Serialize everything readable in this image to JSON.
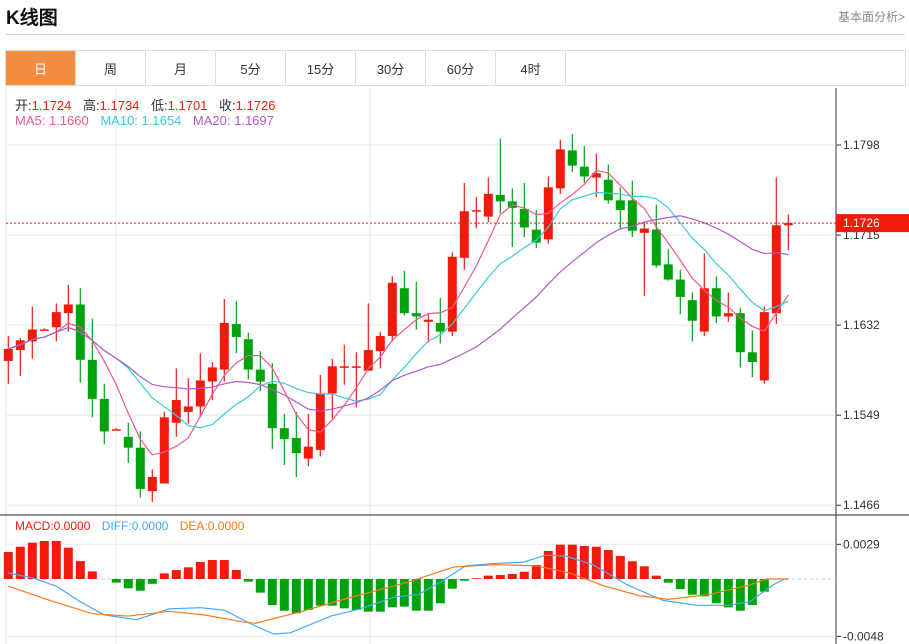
{
  "header": {
    "title": "K线图",
    "more_link": "基本面分析>"
  },
  "tabs": [
    {
      "label": "日",
      "active": true
    },
    {
      "label": "周"
    },
    {
      "label": "月"
    },
    {
      "label": "5分"
    },
    {
      "label": "15分"
    },
    {
      "label": "30分"
    },
    {
      "label": "60分"
    },
    {
      "label": "4时"
    }
  ],
  "ohlc_info": {
    "open_label": "开:",
    "open": "1.1724",
    "high_label": "高:",
    "high": "1.1734",
    "low_label": "低:",
    "low": "1.1701",
    "close_label": "收:",
    "close": "1.1726"
  },
  "ma_info": {
    "ma5": "MA5: 1.1660",
    "ma10": "MA10: 1.1654",
    "ma20": "MA20: 1.1697"
  },
  "macd_info": {
    "macd": "MACD:0.0000",
    "diff": "DIFF:0.0000",
    "dea": "DEA:0.0000"
  },
  "colors": {
    "up": "#f21b0b",
    "down": "#00a30c",
    "ma5": "#f0588f",
    "ma10": "#3cc8dc",
    "ma20": "#b15bc7",
    "diff": "#4aa8f0",
    "dea": "#f47a1f",
    "accent": "#f58c3f"
  },
  "chart_data": [
    {
      "type": "candlestick",
      "price_ticks": [
        "1.1798",
        "1.1715",
        "1.1632",
        "1.1549",
        "1.1466"
      ],
      "ylim": [
        1.1466,
        1.1798
      ],
      "current_price": "1.1726",
      "grid": true,
      "ma_periods": [
        5,
        10,
        20
      ],
      "candles_ohlc": [
        [
          1.1599,
          1.1622,
          1.1578,
          1.161
        ],
        [
          1.1609,
          1.162,
          1.1585,
          1.1618
        ],
        [
          1.1617,
          1.1649,
          1.1601,
          1.1628
        ],
        [
          1.1628,
          1.1629,
          1.1627,
          1.1628
        ],
        [
          1.163,
          1.1652,
          1.1617,
          1.1644
        ],
        [
          1.1643,
          1.1669,
          1.1626,
          1.1651
        ],
        [
          1.1651,
          1.1666,
          1.1579,
          1.16
        ],
        [
          1.16,
          1.1638,
          1.1547,
          1.1564
        ],
        [
          1.1564,
          1.1578,
          1.1522,
          1.1534
        ],
        [
          1.1536,
          1.1537,
          1.1535,
          1.1536
        ],
        [
          1.1529,
          1.1542,
          1.1505,
          1.1519
        ],
        [
          1.1519,
          1.1534,
          1.1473,
          1.1481
        ],
        [
          1.1479,
          1.1499,
          1.1469,
          1.1492
        ],
        [
          1.1486,
          1.1552,
          1.1486,
          1.1547
        ],
        [
          1.1542,
          1.1592,
          1.1529,
          1.1563
        ],
        [
          1.1552,
          1.1583,
          1.1541,
          1.1557
        ],
        [
          1.1557,
          1.1606,
          1.1547,
          1.1581
        ],
        [
          1.158,
          1.1598,
          1.1563,
          1.1593
        ],
        [
          1.1591,
          1.1656,
          1.158,
          1.1634
        ],
        [
          1.1633,
          1.1654,
          1.1606,
          1.1621
        ],
        [
          1.1619,
          1.1625,
          1.1582,
          1.1591
        ],
        [
          1.1591,
          1.1608,
          1.1571,
          1.158
        ],
        [
          1.1578,
          1.1597,
          1.1518,
          1.1537
        ],
        [
          1.1537,
          1.155,
          1.1503,
          1.1527
        ],
        [
          1.1528,
          1.1552,
          1.1492,
          1.1514
        ],
        [
          1.1509,
          1.155,
          1.1502,
          1.152
        ],
        [
          1.1517,
          1.1586,
          1.1511,
          1.1569
        ],
        [
          1.1569,
          1.1601,
          1.1546,
          1.1594
        ],
        [
          1.1594,
          1.1614,
          1.1577,
          1.1594
        ],
        [
          1.1594,
          1.1607,
          1.1556,
          1.1594
        ],
        [
          1.159,
          1.1652,
          1.159,
          1.1609
        ],
        [
          1.1608,
          1.1626,
          1.1592,
          1.1622
        ],
        [
          1.1622,
          1.1677,
          1.1617,
          1.1671
        ],
        [
          1.1666,
          1.1682,
          1.1641,
          1.1643
        ],
        [
          1.1643,
          1.1672,
          1.1628,
          1.164
        ],
        [
          1.1635,
          1.1642,
          1.1616,
          1.1637
        ],
        [
          1.1634,
          1.1657,
          1.1615,
          1.1626
        ],
        [
          1.1626,
          1.1699,
          1.1622,
          1.1695
        ],
        [
          1.1694,
          1.1763,
          1.1683,
          1.1737
        ],
        [
          1.1738,
          1.175,
          1.1721,
          1.1738
        ],
        [
          1.1732,
          1.1768,
          1.1727,
          1.1753
        ],
        [
          1.1752,
          1.1804,
          1.1735,
          1.1746
        ],
        [
          1.1746,
          1.1758,
          1.1704,
          1.174
        ],
        [
          1.1739,
          1.1763,
          1.1713,
          1.1722
        ],
        [
          1.172,
          1.1738,
          1.1703,
          1.1708
        ],
        [
          1.1711,
          1.1769,
          1.1707,
          1.1759
        ],
        [
          1.1758,
          1.1803,
          1.1753,
          1.1794
        ],
        [
          1.1793,
          1.1808,
          1.1773,
          1.1779
        ],
        [
          1.1778,
          1.1797,
          1.1763,
          1.1769
        ],
        [
          1.1768,
          1.179,
          1.175,
          1.1772
        ],
        [
          1.1766,
          1.178,
          1.1744,
          1.1747
        ],
        [
          1.1747,
          1.1759,
          1.1721,
          1.1738
        ],
        [
          1.1747,
          1.1765,
          1.1713,
          1.1719
        ],
        [
          1.1717,
          1.1727,
          1.1659,
          1.1721
        ],
        [
          1.172,
          1.1743,
          1.1685,
          1.1687
        ],
        [
          1.1688,
          1.1702,
          1.1673,
          1.1674
        ],
        [
          1.1674,
          1.1683,
          1.1642,
          1.1658
        ],
        [
          1.1655,
          1.1662,
          1.1617,
          1.1636
        ],
        [
          1.1626,
          1.1698,
          1.1622,
          1.1666
        ],
        [
          1.1666,
          1.1677,
          1.1634,
          1.164
        ],
        [
          1.164,
          1.1662,
          1.1635,
          1.1643
        ],
        [
          1.1643,
          1.1648,
          1.1593,
          1.1607
        ],
        [
          1.1607,
          1.1627,
          1.1584,
          1.1598
        ],
        [
          1.1581,
          1.1649,
          1.1578,
          1.1644
        ],
        [
          1.1643,
          1.1768,
          1.1633,
          1.1724
        ],
        [
          1.1724,
          1.1734,
          1.1701,
          1.1726
        ]
      ]
    },
    {
      "type": "bar+line",
      "ticks": [
        "0.0029",
        "-0.0048"
      ],
      "ylim": [
        -0.0048,
        0.0029
      ],
      "macd_hist": [
        0.00226,
        0.0027,
        0.00304,
        0.00318,
        0.00318,
        0.00262,
        0.0015,
        0.00064,
        0,
        -0.0003,
        -0.00078,
        -0.00098,
        -0.0004,
        0.00047,
        0.00075,
        0.00098,
        0.00142,
        0.00159,
        0.00159,
        0.00075,
        -0.00022,
        -0.00114,
        -0.00217,
        -0.00265,
        -0.00287,
        -0.00259,
        -0.00223,
        -0.00223,
        -0.00245,
        -0.00259,
        -0.00273,
        -0.00273,
        -0.00237,
        -0.00231,
        -0.00265,
        -0.00265,
        -0.00203,
        -0.00081,
        -0.00014,
        6e-05,
        0.00028,
        0.00033,
        0.00042,
        0.00061,
        0.00117,
        0.00234,
        0.00287,
        0.00287,
        0.00276,
        0.0027,
        0.00242,
        0.00192,
        0.00148,
        0.00106,
        0.00028,
        -0.00031,
        -0.00084,
        -0.00131,
        -0.00145,
        -0.00203,
        -0.00237,
        -0.00265,
        -0.00217,
        -0.00106,
        0,
        0
      ],
      "diff": [
        [
          0,
          0.0005
        ],
        [
          2,
          0.0001
        ],
        [
          4,
          -0.0006
        ],
        [
          6,
          -0.0019
        ],
        [
          8,
          -0.003
        ],
        [
          10.7,
          -0.0034
        ],
        [
          13.4,
          -0.0025
        ],
        [
          16,
          -0.0024
        ],
        [
          18,
          -0.0026
        ],
        [
          20.1,
          -0.0037
        ],
        [
          22.1,
          -0.0046
        ],
        [
          23.5,
          -0.0045
        ],
        [
          26.9,
          -0.0031
        ],
        [
          29.3,
          -0.0025
        ],
        [
          32.2,
          -0.0015
        ],
        [
          34.2,
          -0.0013
        ],
        [
          36.1,
          -0.0002
        ],
        [
          38.1,
          0.0011
        ],
        [
          40.5,
          0.0013
        ],
        [
          42.9,
          0.0014
        ],
        [
          44.8,
          0.002
        ],
        [
          46.5,
          0.0019
        ],
        [
          48.7,
          0.0012
        ],
        [
          51.6,
          -0.0005
        ],
        [
          54.6,
          -0.0018
        ],
        [
          57.4,
          -0.0022
        ],
        [
          60,
          -0.0022
        ],
        [
          61.8,
          -0.0019
        ],
        [
          63.7,
          -0.0005
        ],
        [
          64.7,
          0
        ],
        [
          65,
          0
        ]
      ],
      "dea": [
        [
          0,
          -0.0006
        ],
        [
          3.5,
          -0.0018
        ],
        [
          7,
          -0.0029
        ],
        [
          10,
          -0.0031
        ],
        [
          13.4,
          -0.0027
        ],
        [
          16.3,
          -0.003
        ],
        [
          19.6,
          -0.0036
        ],
        [
          20.6,
          -0.0037
        ],
        [
          24.5,
          -0.0027
        ],
        [
          28.3,
          -0.0016
        ],
        [
          33.2,
          -0.0003
        ],
        [
          37.1,
          0.001
        ],
        [
          40.5,
          0.0012
        ],
        [
          44,
          0.0011
        ],
        [
          46.8,
          0.0005
        ],
        [
          49.7,
          -0.0006
        ],
        [
          52.6,
          -0.0014
        ],
        [
          55,
          -0.0017
        ],
        [
          58.4,
          -0.0013
        ],
        [
          61.8,
          -0.0005
        ],
        [
          63.2,
          0
        ],
        [
          65,
          0
        ]
      ]
    }
  ]
}
